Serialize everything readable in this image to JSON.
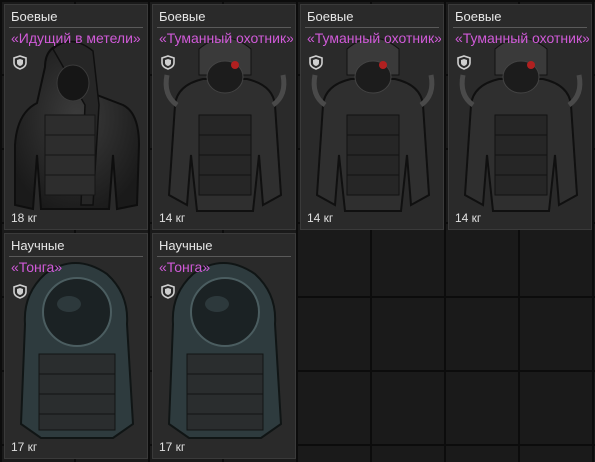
{
  "inventory": {
    "items": [
      {
        "category": "Боевые",
        "name": "«Идущий в метели»",
        "weight": "18 кг",
        "icon": "armor-suit-icon"
      },
      {
        "category": "Боевые",
        "name": "«Туманный охотник»",
        "weight": "14 кг",
        "icon": "armor-suit-icon"
      },
      {
        "category": "Боевые",
        "name": "«Туманный охотник»",
        "weight": "14 кг",
        "icon": "armor-suit-icon"
      },
      {
        "category": "Боевые",
        "name": "«Туманный охотник»",
        "weight": "14 кг",
        "icon": "armor-suit-icon"
      },
      {
        "category": "Научные",
        "name": "«Тонга»",
        "weight": "17 кг",
        "icon": "armor-suit-icon"
      },
      {
        "category": "Научные",
        "name": "«Тонга»",
        "weight": "17 кг",
        "icon": "armor-suit-icon"
      }
    ],
    "colors": {
      "name": "#d05ad8",
      "background": "#141414",
      "card": "#2a2a2a"
    }
  }
}
